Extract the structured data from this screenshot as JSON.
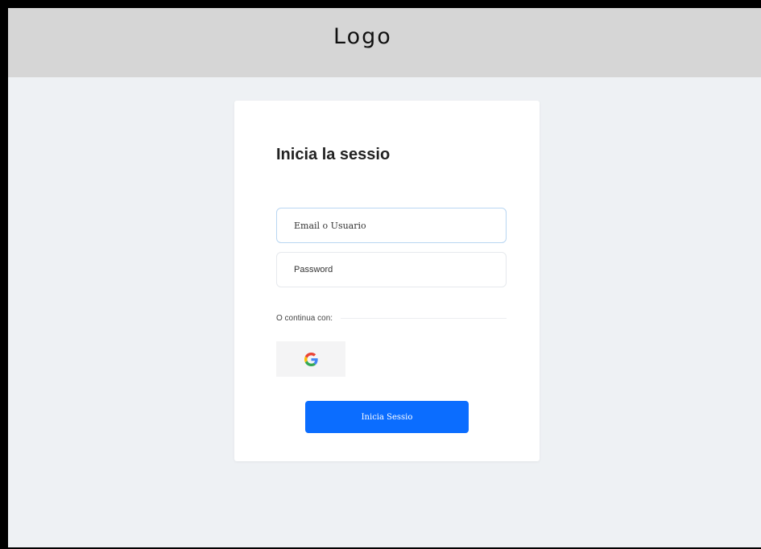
{
  "header": {
    "logo": "Logo"
  },
  "login": {
    "title": "Inicia la sessio",
    "email_placeholder": "Email o Usuario",
    "password_placeholder": "Password",
    "divider_label": "O continua con:",
    "submit_label": "Inicia Sessio"
  },
  "colors": {
    "header_bg": "#d6d6d6",
    "page_bg": "#eef1f4",
    "primary": "#0b6dff"
  },
  "icons": {
    "social": "google-icon"
  }
}
